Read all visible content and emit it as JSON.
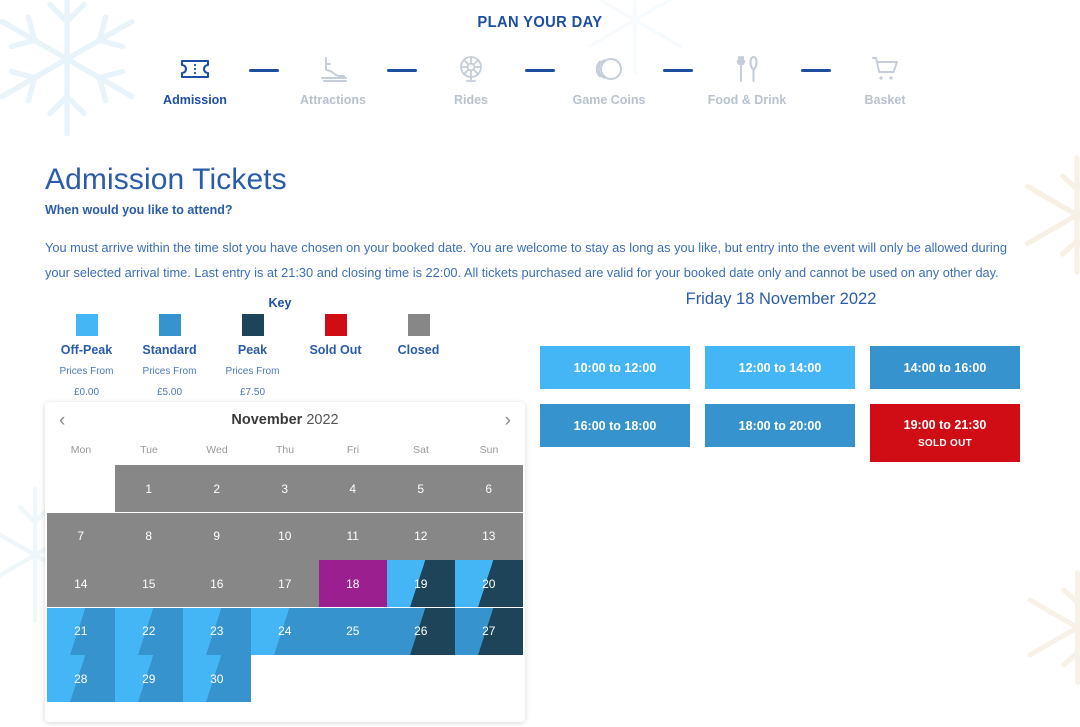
{
  "header": {
    "title": "PLAN YOUR DAY",
    "steps": [
      {
        "label": "Admission",
        "icon": "ticket-icon",
        "active": true
      },
      {
        "label": "Attractions",
        "icon": "ice-skate-icon",
        "active": false
      },
      {
        "label": "Rides",
        "icon": "ferris-wheel-icon",
        "active": false
      },
      {
        "label": "Game Coins",
        "icon": "coins-icon",
        "active": false
      },
      {
        "label": "Food & Drink",
        "icon": "cutlery-icon",
        "active": false
      },
      {
        "label": "Basket",
        "icon": "shopping-cart-icon",
        "active": false
      }
    ]
  },
  "main": {
    "title": "Admission Tickets",
    "question": "When would you like to attend?",
    "blurb": "You must arrive within the time slot you have chosen on your booked date. You are welcome to stay as long as you like, but entry into the event will only be allowed during your selected arrival time. Last entry is at 21:30 and closing time is 22:00. All tickets purchased are valid for your booked date only and cannot be used on any other day."
  },
  "key": {
    "title": "Key",
    "items": [
      {
        "name": "Off-Peak",
        "color": "#45b6f5",
        "from_label": "Prices From",
        "price": "£0.00"
      },
      {
        "name": "Standard",
        "color": "#3793ce",
        "from_label": "Prices From",
        "price": "£5.00"
      },
      {
        "name": "Peak",
        "color": "#1d4459",
        "from_label": "Prices From",
        "price": "£7.50"
      },
      {
        "name": "Sold Out",
        "color": "#d00d15",
        "from_label": "",
        "price": ""
      },
      {
        "name": "Closed",
        "color": "#878787",
        "from_label": "",
        "price": ""
      }
    ]
  },
  "calendar": {
    "prev_label": "‹",
    "next_label": "›",
    "month": "November",
    "year": "2022",
    "day_headers": [
      "Mon",
      "Tue",
      "Wed",
      "Thu",
      "Fri",
      "Sat",
      "Sun"
    ],
    "colors": {
      "offpeak": "#45b6f5",
      "standard": "#3793ce",
      "peak": "#1d4459",
      "soldout": "#d00d15",
      "closed": "#878787",
      "selected": "#9c1f8f"
    },
    "weeks": [
      [
        {
          "day": "",
          "state": "empty"
        },
        {
          "day": "1",
          "state": "closed"
        },
        {
          "day": "2",
          "state": "closed"
        },
        {
          "day": "3",
          "state": "closed"
        },
        {
          "day": "4",
          "state": "closed"
        },
        {
          "day": "5",
          "state": "closed"
        },
        {
          "day": "6",
          "state": "closed"
        }
      ],
      [
        {
          "day": "7",
          "state": "closed"
        },
        {
          "day": "8",
          "state": "closed"
        },
        {
          "day": "9",
          "state": "closed"
        },
        {
          "day": "10",
          "state": "closed"
        },
        {
          "day": "11",
          "state": "closed"
        },
        {
          "day": "12",
          "state": "closed"
        },
        {
          "day": "13",
          "state": "closed"
        }
      ],
      [
        {
          "day": "14",
          "state": "closed"
        },
        {
          "day": "15",
          "state": "closed"
        },
        {
          "day": "16",
          "state": "closed"
        },
        {
          "day": "17",
          "state": "closed"
        },
        {
          "day": "18",
          "state": "selected"
        },
        {
          "day": "19",
          "state": "split",
          "from": "offpeak",
          "to": "peak"
        },
        {
          "day": "20",
          "state": "split",
          "from": "offpeak",
          "to": "peak"
        }
      ],
      [
        {
          "day": "21",
          "state": "split",
          "from": "offpeak",
          "to": "standard"
        },
        {
          "day": "22",
          "state": "split",
          "from": "offpeak",
          "to": "standard"
        },
        {
          "day": "23",
          "state": "split",
          "from": "offpeak",
          "to": "standard"
        },
        {
          "day": "24",
          "state": "split",
          "from": "offpeak",
          "to": "standard"
        },
        {
          "day": "25",
          "state": "standard"
        },
        {
          "day": "26",
          "state": "split",
          "from": "standard",
          "to": "peak"
        },
        {
          "day": "27",
          "state": "split",
          "from": "standard",
          "to": "peak"
        }
      ],
      [
        {
          "day": "28",
          "state": "split",
          "from": "offpeak",
          "to": "standard"
        },
        {
          "day": "29",
          "state": "split",
          "from": "offpeak",
          "to": "standard"
        },
        {
          "day": "30",
          "state": "split",
          "from": "offpeak",
          "to": "standard"
        },
        {
          "day": "",
          "state": "empty"
        },
        {
          "day": "",
          "state": "empty"
        },
        {
          "day": "",
          "state": "empty"
        },
        {
          "day": "",
          "state": "empty"
        }
      ]
    ]
  },
  "slots": {
    "date": "Friday 18 November 2022",
    "sold_out_label": "SOLD OUT",
    "items": [
      {
        "time": "10:00 to 12:00",
        "color": "#45b6f5",
        "sold_out": false
      },
      {
        "time": "12:00 to 14:00",
        "color": "#45b6f5",
        "sold_out": false
      },
      {
        "time": "14:00 to 16:00",
        "color": "#3793ce",
        "sold_out": false
      },
      {
        "time": "16:00 to 18:00",
        "color": "#3793ce",
        "sold_out": false
      },
      {
        "time": "18:00 to 20:00",
        "color": "#3793ce",
        "sold_out": false
      },
      {
        "time": "19:00 to 21:30",
        "color": "#d00d15",
        "sold_out": true
      }
    ]
  }
}
